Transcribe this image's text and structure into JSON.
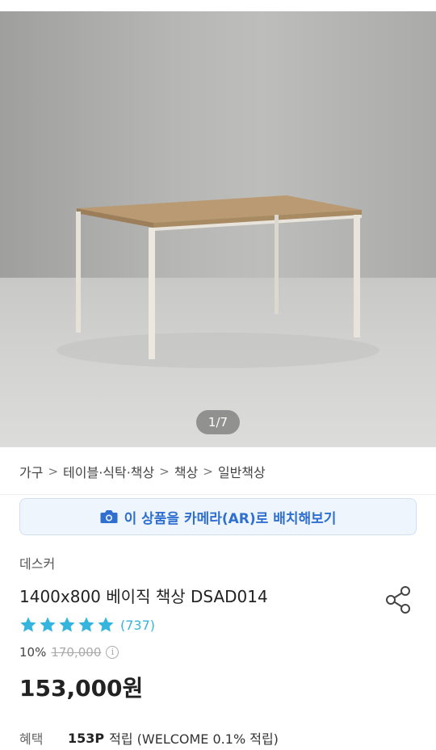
{
  "product_image": {
    "counter": "1/7"
  },
  "breadcrumb": {
    "items": [
      "가구",
      "테이블·식탁·책상",
      "책상",
      "일반책상"
    ]
  },
  "ar_button": {
    "label": "이 상품을 카메라(AR)로 배치해보기",
    "icon": "camera-icon"
  },
  "product": {
    "brand": "데스커",
    "title": "1400x800 베이직 책상 DSAD014",
    "rating_stars": 5,
    "review_count": "(737)",
    "discount": "10%",
    "original_price": "170,000",
    "price": "153,000원"
  },
  "benefit": {
    "label": "혜택",
    "points": "153P",
    "description": "적립 (WELCOME 0.1% 적립)"
  },
  "colors": {
    "accent_blue": "#2f6fd0",
    "star": "#35b4dd",
    "ar_bg": "#eef5fd"
  }
}
